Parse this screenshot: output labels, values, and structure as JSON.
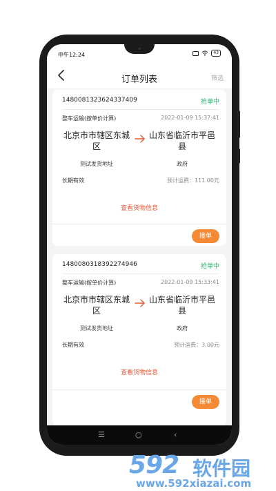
{
  "status_bar": {
    "time": "中午12:24",
    "battery": "43"
  },
  "header": {
    "title": "订单列表",
    "filter_label": "筛选"
  },
  "orders": [
    {
      "id": "1480081323624337409",
      "status": "抢单中",
      "type": "整车运输(按单价计算)",
      "time": "2022-01-09 15:37:41",
      "from": "北京市市辖区东城区",
      "to": "山东省临沂市平邑县",
      "from_detail": "测试发货地址",
      "to_detail": "政府",
      "validity": "长期有效",
      "fee": "预计运费：111.00元",
      "view_label": "查看货物信息",
      "accept_label": "接单"
    },
    {
      "id": "1480080318392274946",
      "status": "抢单中",
      "type": "整车运输(按单价计算)",
      "time": "2022-01-09 15:33:41",
      "from": "北京市市辖区东城区",
      "to": "山东省临沂市平邑县",
      "from_detail": "测试发货地址",
      "to_detail": "政府",
      "validity": "长期有效",
      "fee": "预计运费：3.00元",
      "view_label": "查看货物信息",
      "accept_label": "接单"
    }
  ],
  "watermark": {
    "number": "592",
    "text": "软件园",
    "url": "www.592xiazai.com"
  },
  "colors": {
    "status_green": "#24b56e",
    "accent_orange": "#f58a35",
    "link_red": "#e25a3c",
    "watermark_blue": "#6aa7e8"
  }
}
